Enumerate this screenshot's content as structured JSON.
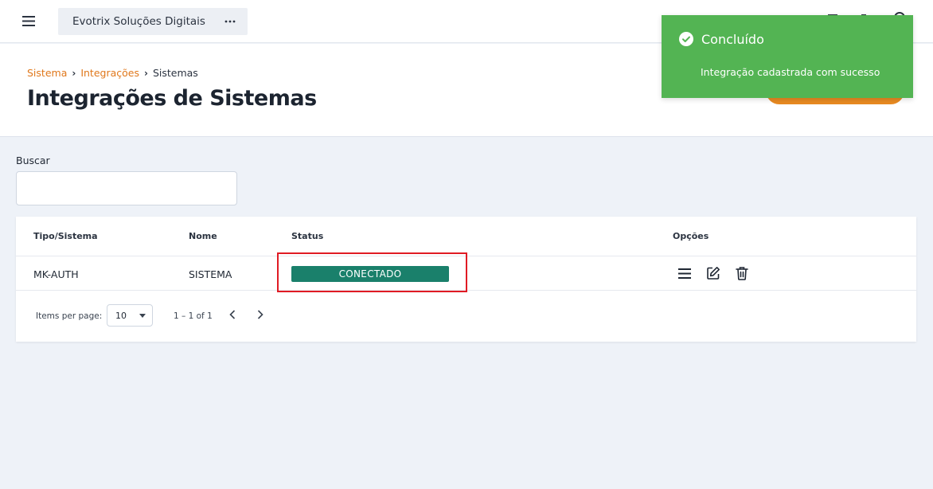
{
  "topbar": {
    "company_name": "Evotrix Soluções Digitais"
  },
  "breadcrumb": {
    "items": [
      "Sistema",
      "Integrações",
      "Sistemas"
    ]
  },
  "page": {
    "title": "Integrações de Sistemas"
  },
  "search": {
    "label": "Buscar",
    "value": "",
    "placeholder": ""
  },
  "table": {
    "headers": [
      "Tipo/Sistema",
      "Nome",
      "Status",
      "Opções"
    ],
    "rows": [
      {
        "tipo": "MK-AUTH",
        "nome": "SISTEMA",
        "status": "CONECTADO"
      }
    ]
  },
  "pagination": {
    "items_per_page_label": "Items per page:",
    "page_size": "10",
    "range": "1 – 1 of 1"
  },
  "toast": {
    "title": "Concluído",
    "message": "Integração cadastrada com sucesso"
  },
  "colors": {
    "accent": "#e0781c",
    "status_connected": "#1a806b",
    "toast_success": "#53b453",
    "highlight": "#e01b24"
  },
  "icons": {
    "menu": "hamburger-menu-icon",
    "more": "more-horizontal-icon",
    "details": "list-icon",
    "edit": "edit-icon",
    "delete": "trash-icon",
    "prev": "chevron-left-icon",
    "next": "chevron-right-icon",
    "toast": "check-circle-icon"
  }
}
